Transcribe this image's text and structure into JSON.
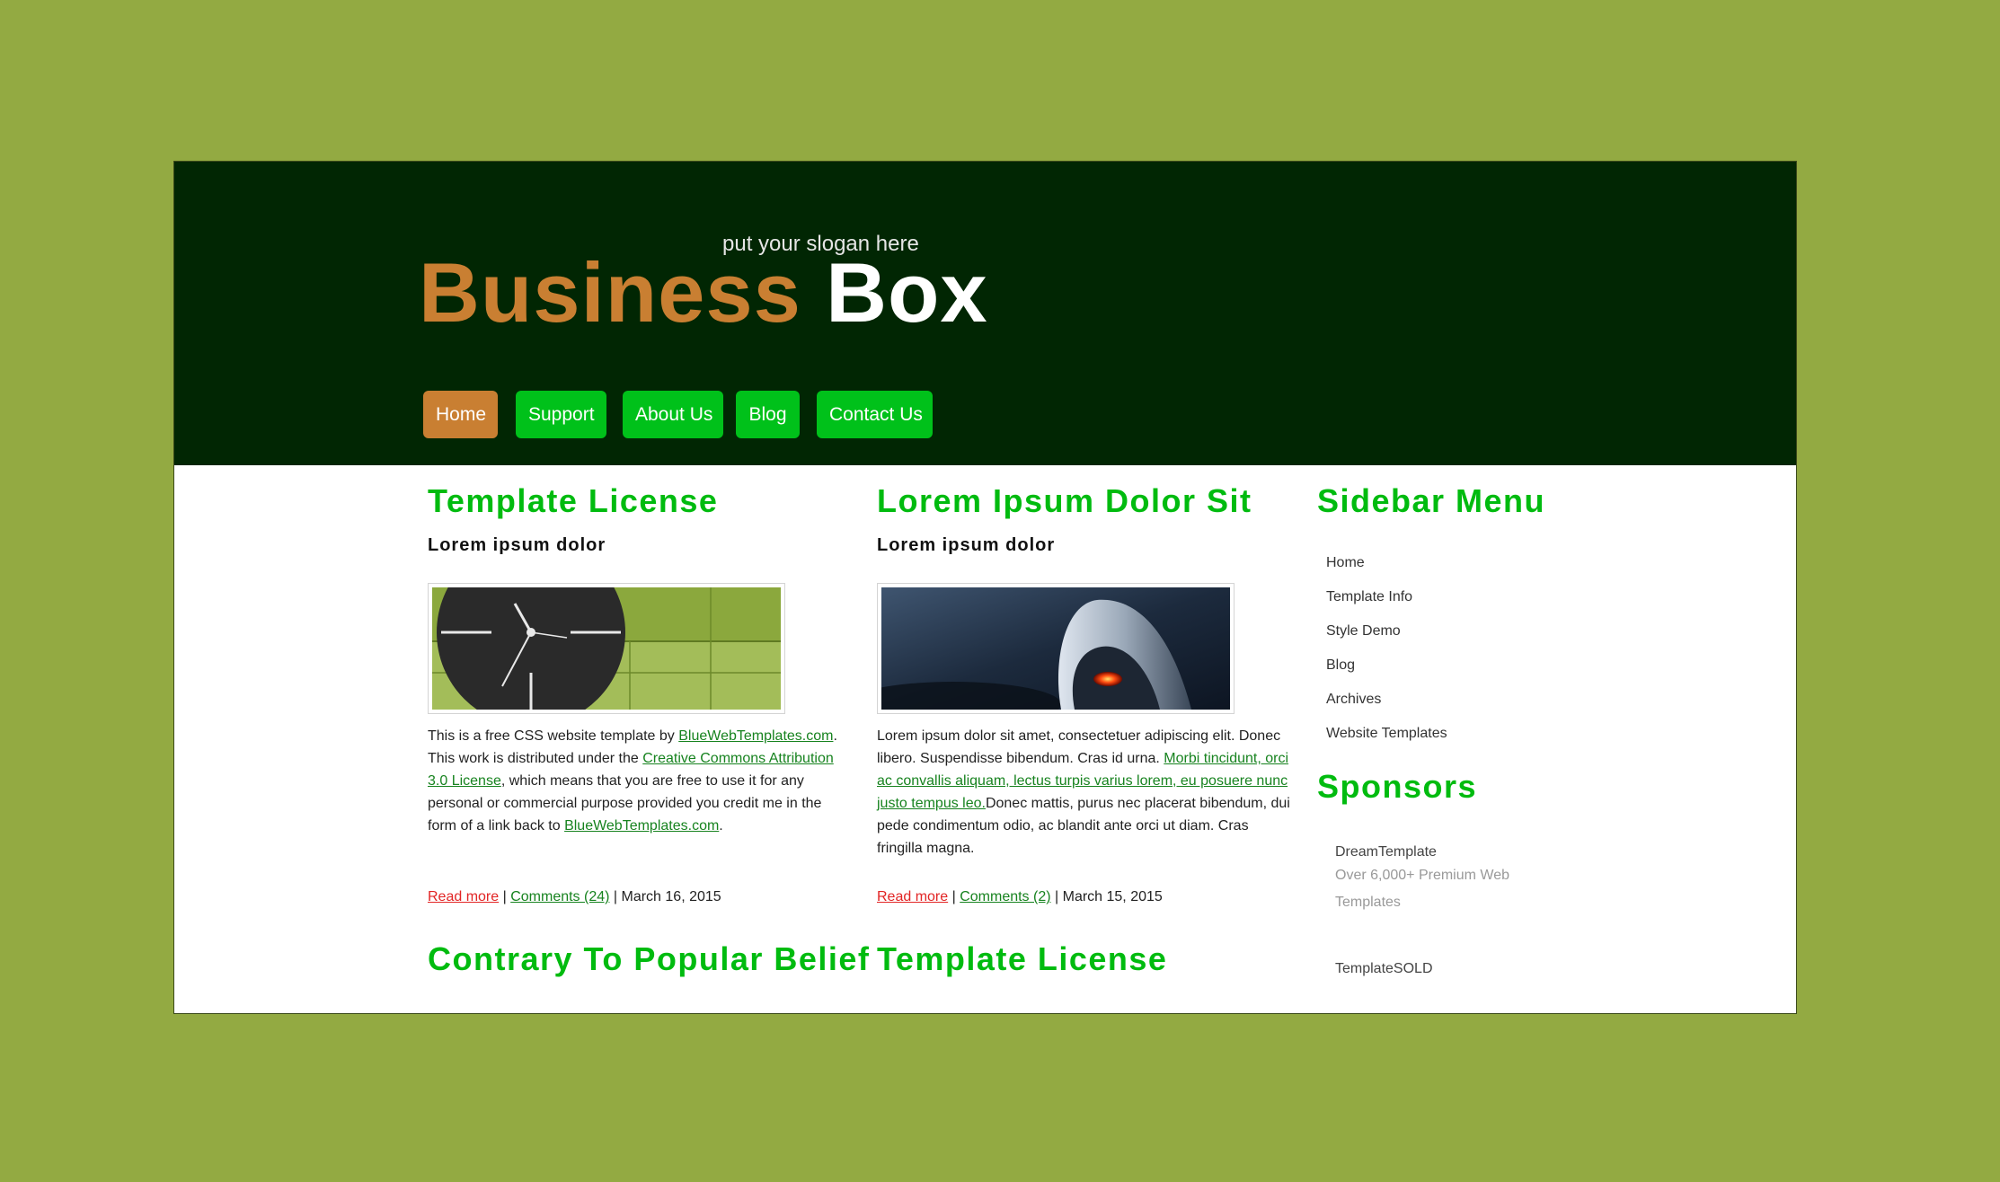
{
  "site": {
    "slogan": "put your slogan here",
    "logo_first": "Business",
    "logo_second": "Box",
    "colors": {
      "page_bg": "#93aa42",
      "header_bg": "#012603",
      "accent_green": "#00bb0f",
      "accent_orange": "#c97f32"
    }
  },
  "nav": {
    "items": [
      {
        "label": "Home",
        "active": true
      },
      {
        "label": "Support"
      },
      {
        "label": "About Us"
      },
      {
        "label": "Blog"
      },
      {
        "label": "Contact Us"
      }
    ]
  },
  "posts": [
    {
      "title": "Template License",
      "subtitle": "Lorem ipsum dolor",
      "image": "clock-image",
      "body": {
        "t1": "This is a free CSS website template by ",
        "l1": "BlueWebTemplates.com",
        "t2": ". This work is distributed under the ",
        "l2": "Creative Commons Attribution 3.0 License",
        "t3": ", which means that you are free to use it for any personal or commercial purpose provided you credit me in the form of a link back to ",
        "l3": "BlueWebTemplates.com",
        "t4": "."
      },
      "read_more": "Read more",
      "comments": "Comments (24)",
      "date": "March 16, 2015"
    },
    {
      "title": "Lorem Ipsum Dolor Sit",
      "subtitle": "Lorem ipsum dolor",
      "image": "computer-mouse-image",
      "body": {
        "t1": "Lorem ipsum dolor sit amet, consectetuer adipiscing elit. Donec libero. Suspendisse bibendum. Cras id urna. ",
        "l1": "Morbi tincidunt, orci ac convallis aliquam, lectus turpis varius lorem, eu posuere nunc justo tempus leo.",
        "t2": "Donec mattis, purus nec placerat bibendum, dui pede condimentum odio, ac blandit ante orci ut diam. Cras fringilla magna."
      },
      "read_more": "Read more",
      "comments": "Comments (2)",
      "date": "March 15, 2015"
    }
  ],
  "bottom_headings": [
    "Contrary To Popular Belief",
    "Template License"
  ],
  "sidebar": {
    "menu_title": "Sidebar Menu",
    "menu_items": [
      "Home",
      "Template Info",
      "Style Demo",
      "Blog",
      "Archives",
      "Website Templates"
    ],
    "sponsors_title": "Sponsors",
    "sponsors": [
      {
        "name": "DreamTemplate",
        "description": "Over 6,000+ Premium Web Templates"
      },
      {
        "name": "TemplateSOLD"
      }
    ]
  }
}
